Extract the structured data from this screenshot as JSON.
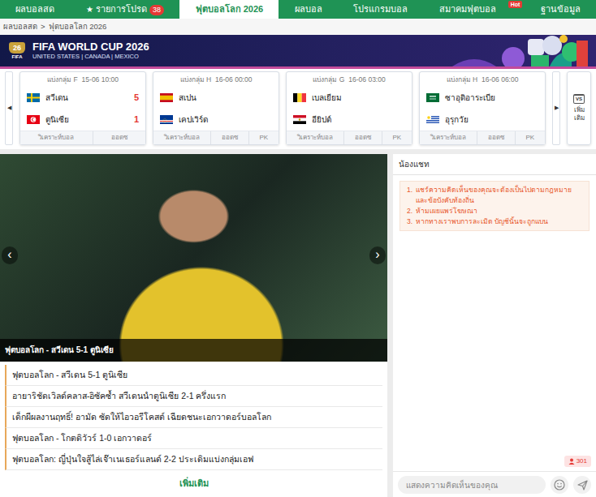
{
  "nav": {
    "tabs": [
      {
        "label": "ผลบอลสด",
        "selected": false
      },
      {
        "label": "รายการโปรด",
        "icon": "★",
        "badge": {
          "text": "38",
          "kind": "count"
        },
        "selected": false
      },
      {
        "label": "ฟุตบอลโลก 2026",
        "selected": true
      },
      {
        "label": "ผลบอล",
        "selected": false
      },
      {
        "label": "โปรแกรมบอล",
        "selected": false
      },
      {
        "label": "สมาคมฟุตบอล",
        "badge": {
          "text": "Hot",
          "kind": "hot"
        },
        "selected": false
      },
      {
        "label": "ฐานข้อมูล",
        "selected": false
      }
    ]
  },
  "breadcrumb": {
    "items": [
      "ผลบอลสด",
      "ฟุตบอลโลก 2026"
    ],
    "separator": ">"
  },
  "banner": {
    "logo_number": "26",
    "logo_label": "FIFA",
    "title": "FIFA WORLD CUP 2026",
    "subtitle": "UNITED STATES | CANADA | MEXICO"
  },
  "matches": {
    "prev": "◀",
    "next": "▶",
    "more": {
      "icon_text": "VS",
      "label": "เพิ่มเติม"
    },
    "items": [
      {
        "group": "แบ่งกลุ่ม F",
        "time": "15-06 10:00",
        "home": {
          "name": "สวีเดน",
          "score": "5"
        },
        "away": {
          "name": "ตูนิเซีย",
          "score": "1"
        },
        "links": [
          "วิเคราะห์บอล",
          "ออดซ"
        ]
      },
      {
        "group": "แบ่งกลุ่ม H",
        "time": "16-06 00:00",
        "home": {
          "name": "สเปน"
        },
        "away": {
          "name": "เคปเวิร์ด"
        },
        "links": [
          "วิเคราะห์บอล",
          "ออดซ",
          "PK"
        ]
      },
      {
        "group": "แบ่งกลุ่ม G",
        "time": "16-06 03:00",
        "home": {
          "name": "เบลเยียม"
        },
        "away": {
          "name": "อียิปต์"
        },
        "links": [
          "วิเคราะห์บอล",
          "ออดซ",
          "PK"
        ]
      },
      {
        "group": "แบ่งกลุ่ม H",
        "time": "16-06 06:00",
        "home": {
          "name": "ซาอุดิอาระเบีย"
        },
        "away": {
          "name": "อุรุกวัย"
        },
        "links": [
          "วิเคราะห์บอล",
          "ออดซ",
          "PK"
        ]
      }
    ]
  },
  "slider": {
    "prev": "‹",
    "next": "›",
    "caption": "ฟุตบอลโลก - สวีเดน 5-1 ตูนิเซีย"
  },
  "news": {
    "items": [
      "ฟุตบอลโลก - สวีเดน 5-1 ตูนิเซีย",
      "อายาริชัดเวิลด์คลาส-อิซัคซ้ำ สวีเดนนำตูนิเซีย 2-1 ครึ่งแรก",
      "เด็กผีผลงานฤทธิ์! อามัด ซัดให้ไอวอรีโคสต์ เฉียดชนะเอกวาดอร์บอลโลก",
      "ฟุตบอลโลก - โกตดิวัวร์ 1-0 เอกวาดอร์",
      "ฟุตบอลโลก: ญี่ปุ่นใจสู้ไล่เจ๊าเนเธอร์แลนด์ 2-2 ประเดิมแบ่งกลุ่มเอฟ"
    ],
    "more": "เพิ่มเติม"
  },
  "chat": {
    "title": "น้องแชท",
    "rules": [
      {
        "number": "1.",
        "text": "แชร์ความคิดเห็นของคุณจะต้องเป็นไปตามกฎหมายและข้อบังคับท้องถิ่น"
      },
      {
        "number": "2.",
        "text": "ห้ามเผยแพร่โฆษณา"
      },
      {
        "number": "3.",
        "text": "หากทางเราพบการละเมิด บัญชีนั้นจะถูกแบน"
      }
    ],
    "online": "301",
    "placeholder": "แสดงความคิดเห็นของคุณ"
  }
}
